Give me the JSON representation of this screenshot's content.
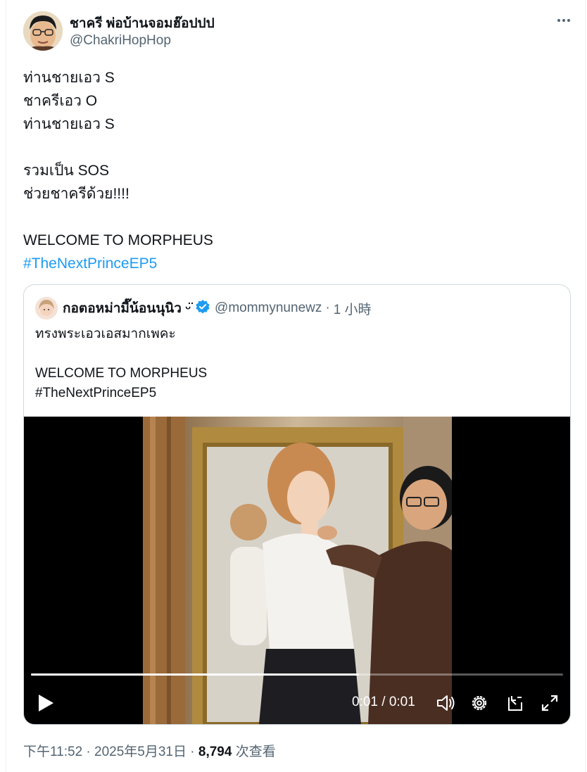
{
  "author": {
    "display_name": "ชาครี พ่อบ้านจอมฮ๊อปปป",
    "handle": "@ChakriHopHop"
  },
  "tweet": {
    "lines": [
      "ท่านชายเอว S",
      "ชาครีเอว O",
      "ท่านชายเอว S",
      "",
      "รวมเป็น SOS",
      "ช่วยชาครีด้วย!!!!",
      "",
      "WELCOME TO MORPHEUS"
    ],
    "hashtag": "#TheNextPrinceEP5"
  },
  "quote": {
    "display_name": "กอตอหม่ามี๊น้อนนุนิว ᵕ̈",
    "handle": "@mommynunewz",
    "separator": "·",
    "time": "1 小時",
    "lines": [
      "ทรงพระเอวเอสมากเพคะ",
      "",
      "WELCOME TO MORPHEUS",
      "#TheNextPrinceEP5"
    ]
  },
  "video": {
    "time_display": "0:01 / 0:01",
    "progress_fraction": 0.617,
    "icons": [
      "play-icon",
      "volume-icon",
      "settings-icon",
      "dock-icon",
      "fullscreen-icon"
    ]
  },
  "meta": {
    "timestamp": "下午11:52 · 2025年5月31日 · ",
    "views_count": "8,794",
    "views_label": " 次查看"
  },
  "colors": {
    "accent": "#1d9bf0",
    "text": "#0f1419",
    "secondary_text": "#536471",
    "border": "#cfd9de"
  }
}
